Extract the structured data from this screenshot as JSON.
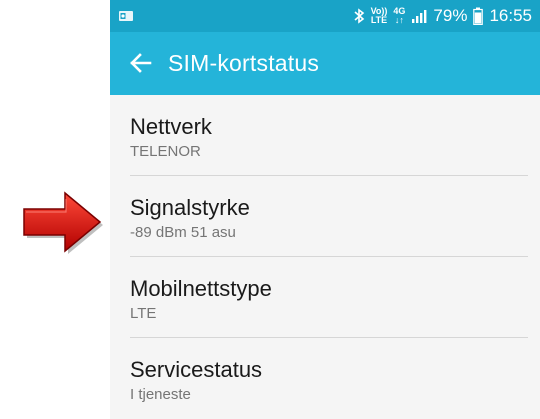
{
  "colors": {
    "status_bar": "#19a3c7",
    "app_bar": "#24b4d9",
    "list_background": "#f5f5f5",
    "title_text": "#1a1a1a",
    "subtitle_text": "#757575",
    "arrow": "#e31212"
  },
  "status_bar": {
    "notification_icon": "outlook-icon",
    "bluetooth_icon": "bluetooth-icon",
    "volte_top": "Vo))",
    "volte_bottom": "LTE",
    "network_top": "4G",
    "network_bottom": "↓↑",
    "signal_icon": "signal-icon",
    "battery_percent": "79%",
    "battery_icon": "battery-icon",
    "time": "16:55"
  },
  "app_bar": {
    "back_icon": "back-arrow-icon",
    "title": "SIM-kortstatus"
  },
  "items": [
    {
      "title": "Nettverk",
      "value": "TELENOR"
    },
    {
      "title": "Signalstyrke",
      "value": "-89 dBm 51 asu"
    },
    {
      "title": "Mobilnettstype",
      "value": "LTE"
    },
    {
      "title": "Servicestatus",
      "value": "I tjeneste"
    }
  ],
  "annotation": {
    "icon": "red-arrow-icon",
    "points_to": "Signalstyrke"
  }
}
